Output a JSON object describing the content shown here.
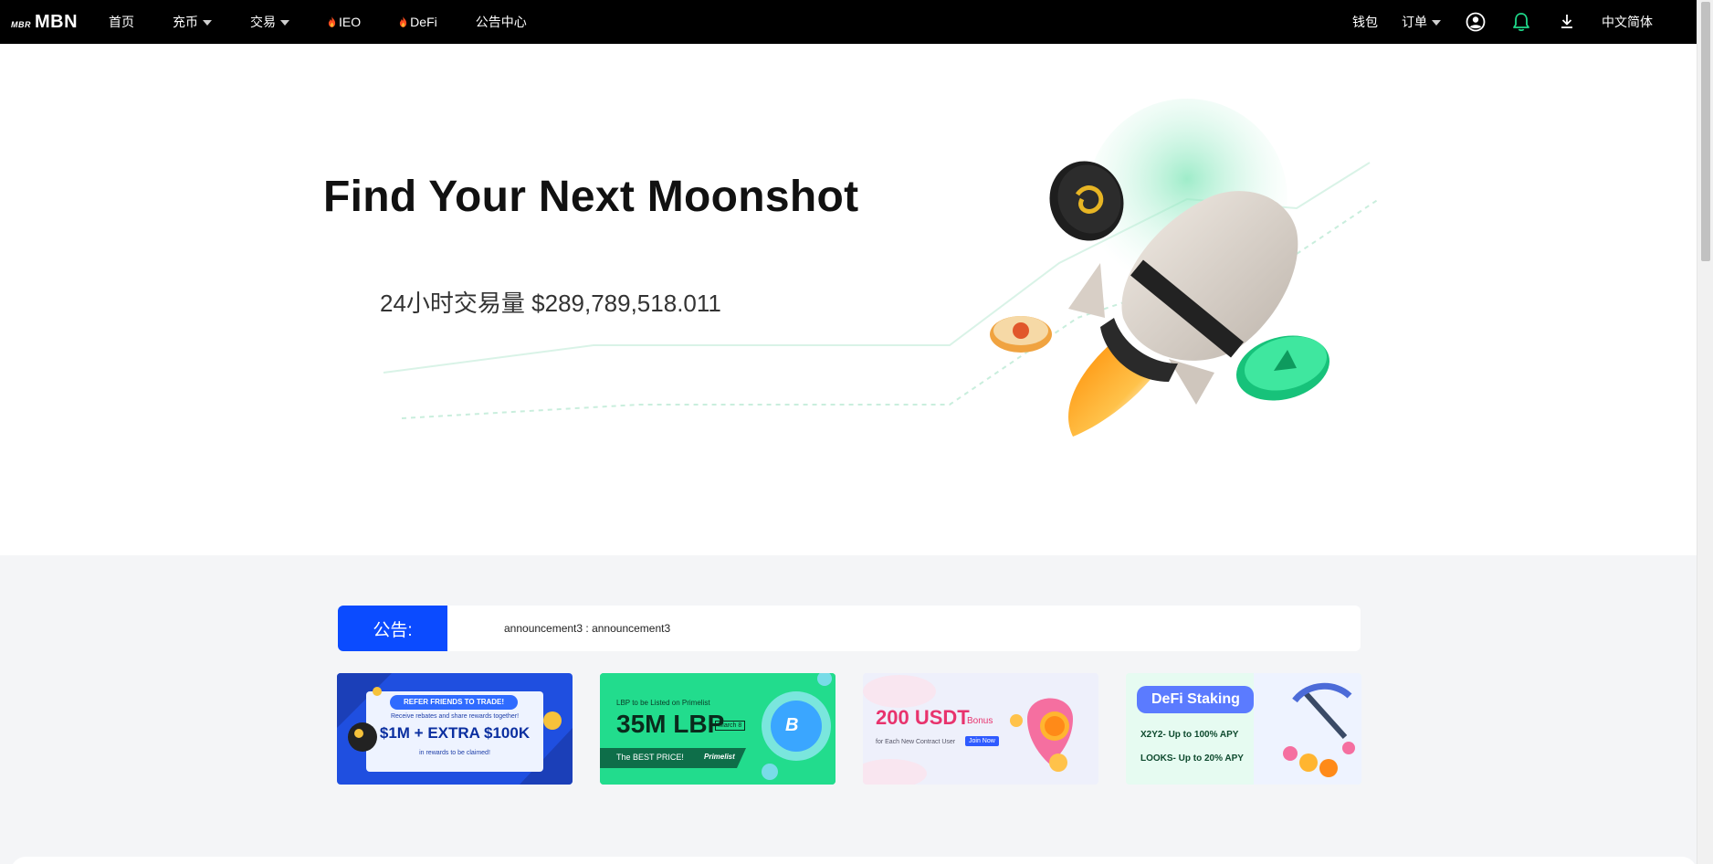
{
  "header": {
    "logo_small": "MBR",
    "logo_big": "MBN",
    "nav": [
      {
        "label": "首页"
      },
      {
        "label": "充币"
      },
      {
        "label": "交易"
      },
      {
        "label": "IEO"
      },
      {
        "label": "DeFi"
      },
      {
        "label": "公告中心"
      }
    ],
    "wallet_label": "钱包",
    "orders_label": "订单",
    "language_label": "中文简体"
  },
  "hero": {
    "title": "Find Your Next Moonshot",
    "volume": "24小时交易量 $289,789,518.011"
  },
  "announcement": {
    "label": "公告:",
    "text": "announcement3 : announcement3"
  },
  "banners": [
    {
      "line1": "REFER FRIENDS TO TRADE!",
      "line2": "Receive rebates and share rewards together!",
      "line3": "$1M + EXTRA $100K",
      "line4": "in rewards to be claimed!"
    },
    {
      "line1": "LBP to be Listed on Primelist",
      "line2": "35M LBP",
      "line3": "March 8",
      "line4": "The BEST PRICE!",
      "line5": "Primelist"
    },
    {
      "line1": "200 USDT",
      "line2": "Bonus",
      "line3": "for Each New Contract User",
      "line4": "Join Now"
    },
    {
      "line1": "DeFi Staking",
      "line2": "X2Y2- Up to 100% APY",
      "line3": "LOOKS- Up to 20% APY"
    }
  ],
  "colors": {
    "nav_bg": "#000000",
    "announce_blue": "#0b4bff",
    "lower_bg": "#f4f5f7",
    "accent_green": "#1fd98a"
  },
  "icons": [
    "user-icon",
    "bell-icon",
    "download-icon",
    "flame-icon",
    "caret-down-icon"
  ]
}
